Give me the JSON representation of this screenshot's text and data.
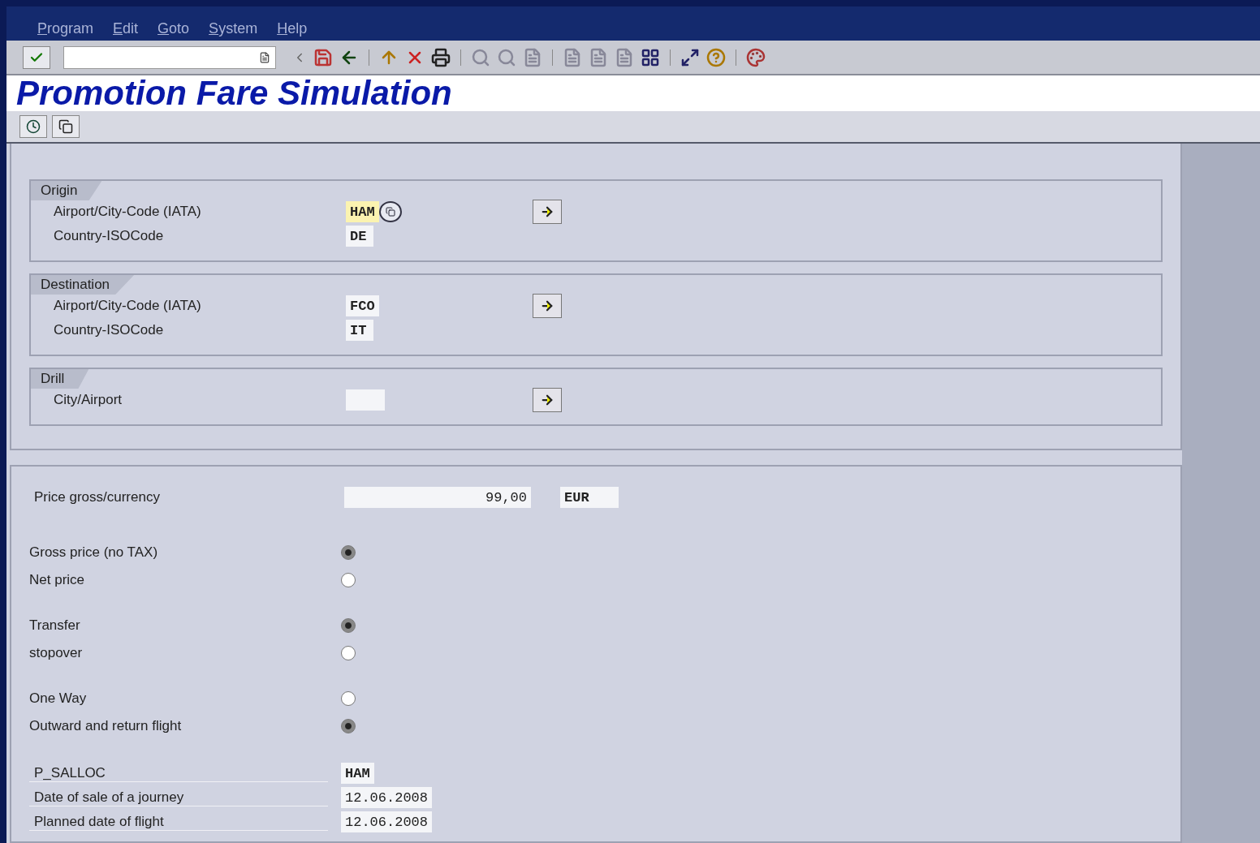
{
  "menu": [
    "Program",
    "Edit",
    "Goto",
    "System",
    "Help"
  ],
  "title": "Promotion Fare Simulation",
  "groups": [
    {
      "title": "Origin",
      "fields": [
        {
          "label": "Airport/City-Code (IATA)",
          "value": "HAM",
          "focused": true
        },
        {
          "label": "Country-ISOCode",
          "value": "DE",
          "focused": false
        }
      ]
    },
    {
      "title": "Destination",
      "fields": [
        {
          "label": "Airport/City-Code (IATA)",
          "value": "FCO",
          "focused": false
        },
        {
          "label": "Country-ISOCode",
          "value": "IT",
          "focused": false
        }
      ]
    },
    {
      "title": "Drill",
      "fields": [
        {
          "label": "City/Airport",
          "focused": false
        }
      ]
    }
  ],
  "price": {
    "label": "Price gross/currency",
    "amount": "99,00",
    "currency": "EUR"
  },
  "radio_groups": [
    [
      {
        "label": "Gross price (no TAX)",
        "selected": true
      },
      {
        "label": "Net price",
        "selected": false
      }
    ],
    [
      {
        "label": "Transfer",
        "selected": true
      },
      {
        "label": "stopover",
        "selected": false
      }
    ],
    [
      {
        "label": "One Way",
        "selected": false
      },
      {
        "label": "Outward and return flight",
        "selected": true
      }
    ]
  ],
  "params": [
    {
      "label": "P_SALLOC",
      "value": "HAM"
    },
    {
      "label": "Date of sale of a journey",
      "value": "12.06.2008"
    },
    {
      "label": "Planned date of flight",
      "value": "12.06.2008"
    }
  ]
}
